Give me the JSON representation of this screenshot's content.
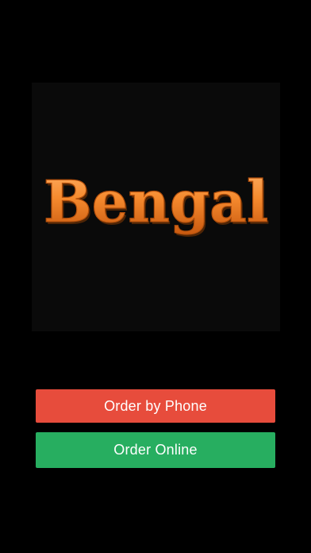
{
  "logo": {
    "text": "Bengal",
    "text_color": "#f07a1e",
    "tile_color": "#0a0a0a"
  },
  "buttons": {
    "phone_label": "Order by Phone",
    "phone_color": "#e74c3c",
    "online_label": "Order Online",
    "online_color": "#27ae60"
  }
}
